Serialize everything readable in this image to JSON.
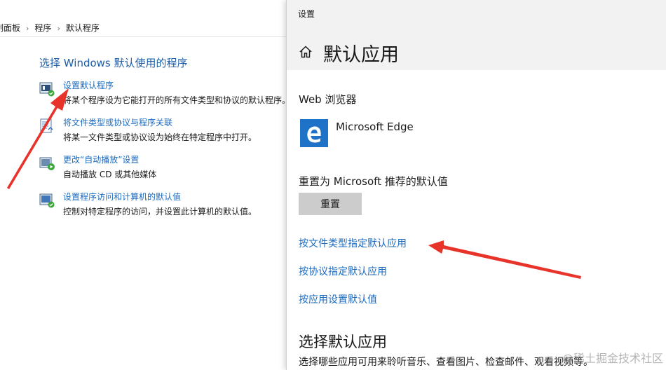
{
  "control_panel": {
    "breadcrumb": [
      "制面板",
      "程序",
      "默认程序"
    ],
    "heading": "选择 Windows 默认使用的程序",
    "items": [
      {
        "link": "设置默认程序",
        "description": "将某个程序设为它能打开的所有文件类型和协议的默认程序。",
        "icon": "default-programs-icon"
      },
      {
        "link": "将文件类型或协议与程序关联",
        "description": "将某一文件类型或协议设为始终在特定程序中打开。",
        "icon": "file-association-icon"
      },
      {
        "link": "更改“自动播放”设置",
        "description": "自动播放 CD 或其他媒体",
        "icon": "autoplay-icon"
      },
      {
        "link": "设置程序访问和计算机的默认值",
        "description": "控制对特定程序的访问，并设置此计算机的默认值。",
        "icon": "program-access-icon"
      }
    ]
  },
  "settings": {
    "window_title": "设置",
    "page_title": "默认应用",
    "web_browser_label": "Web 浏览器",
    "browser_name": "Microsoft Edge",
    "reset_label": "重置为 Microsoft 推荐的默认值",
    "reset_button": "重置",
    "links": {
      "by_file_type": "按文件类型指定默认应用",
      "by_protocol": "按协议指定默认应用",
      "by_app": "按应用设置默认值"
    },
    "choose_title": "选择默认应用",
    "choose_description": "选择哪些应用可用来聆听音乐、查看图片、检查邮件、观看视频等。"
  },
  "watermark": "@稀土掘金技术社区",
  "colors": {
    "link": "#1c6bbf",
    "heading": "#1e5fa8",
    "edge_tile": "#1e73c8",
    "arrow": "#e8332a",
    "reset_button": "#cccccc",
    "header_bg": "#f2f2f2"
  }
}
